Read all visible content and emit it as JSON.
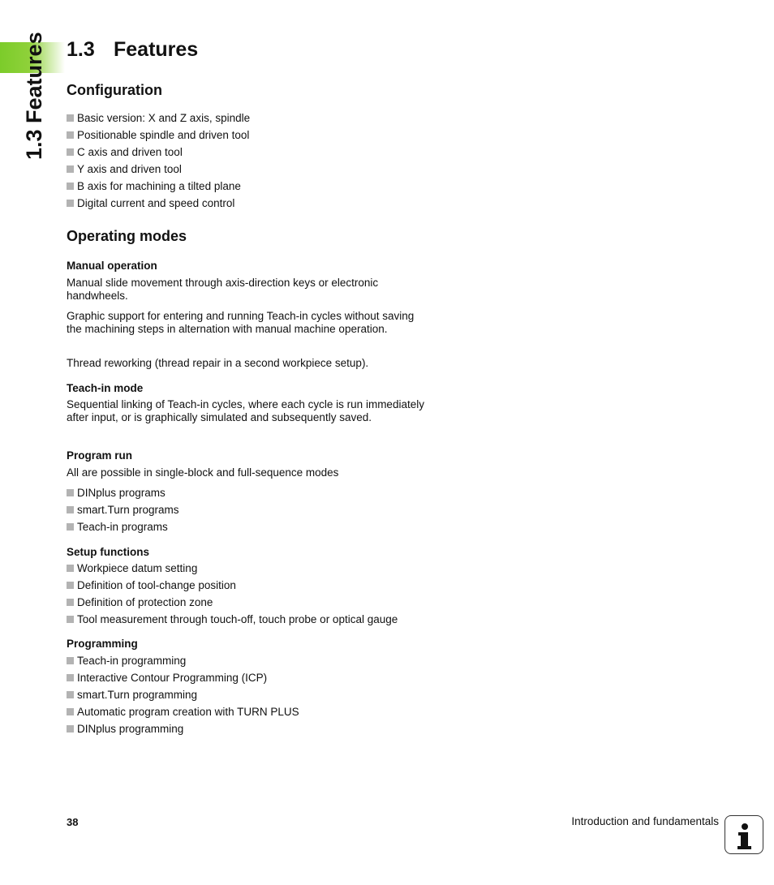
{
  "side_tab": {
    "label": "1.3 Features",
    "color": "#7ccc2a"
  },
  "title": {
    "number": "1.3",
    "text": "Features"
  },
  "configuration": {
    "heading": "Configuration",
    "items": [
      "Basic version: X and Z axis, spindle",
      "Positionable spindle and driven tool",
      "C axis and driven tool",
      "Y axis and driven tool",
      "B axis for machining a tilted plane",
      "Digital current and speed control"
    ]
  },
  "operating_modes": {
    "heading": "Operating modes",
    "manual": {
      "heading": "Manual operation",
      "paragraphs": [
        "Manual slide movement through axis-direction keys or electronic handwheels.",
        "Graphic support for entering and running Teach-in cycles without saving the machining steps in alternation with manual machine operation.",
        "Thread reworking (thread repair in a second workpiece setup)."
      ]
    },
    "teach_in": {
      "heading": "Teach-in mode",
      "paragraph": "Sequential linking of Teach-in cycles, where each cycle is run immediately after input, or is graphically simulated and subsequently saved."
    },
    "program_run": {
      "heading": "Program run",
      "paragraph": "All are possible in single-block and full-sequence modes",
      "items": [
        "DINplus programs",
        "smart.Turn programs",
        "Teach-in programs"
      ]
    },
    "setup": {
      "heading": "Setup functions",
      "items": [
        "Workpiece datum setting",
        "Definition of tool-change position",
        "Definition of protection zone",
        "Tool measurement through touch-off, touch probe or optical gauge"
      ]
    },
    "programming": {
      "heading": "Programming",
      "items": [
        "Teach-in programming",
        "Interactive Contour Programming (ICP)",
        "smart.Turn programming",
        "Automatic program creation with TURN PLUS",
        "DINplus programming"
      ]
    }
  },
  "footer": {
    "page_number": "38",
    "chapter": "Introduction and fundamentals",
    "icon": "info-icon"
  }
}
